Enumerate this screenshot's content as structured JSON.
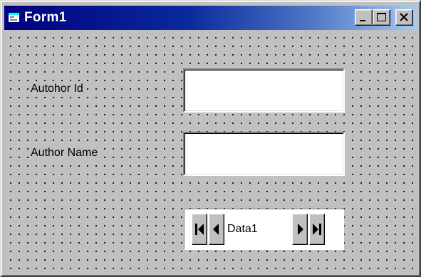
{
  "window": {
    "title": "Form1",
    "icon": "form-window-icon",
    "buttons": [
      "minimize-icon",
      "maximize-icon",
      "close-icon"
    ]
  },
  "form": {
    "author_id_label": "Autohor Id",
    "author_id_value": "",
    "author_name_label": "Author Name",
    "author_name_value": ""
  },
  "data_control": {
    "caption": "Data1",
    "buttons": [
      "move-first-icon",
      "move-previous-icon",
      "move-next-icon",
      "move-last-icon"
    ]
  },
  "colors": {
    "face": "#c0c0c0",
    "titlebar_start": "#000080",
    "titlebar_end": "#a6caf0",
    "title_text": "#ffffff"
  }
}
